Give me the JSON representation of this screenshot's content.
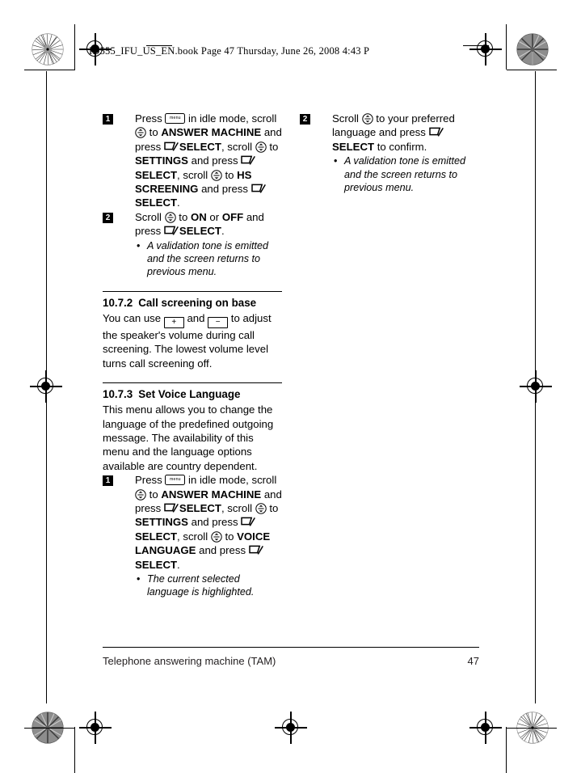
{
  "header": {
    "text": "ID555_IFU_US_EN.book  Page 47  Thursday, June 26, 2008  4:43 P"
  },
  "icons": {
    "menu_label": "menu",
    "volume_up_label": "+",
    "volume_down_label": "−",
    "scroll_name": "scroll-wheel-icon",
    "softkey_name": "softkey-icon"
  },
  "left_column": {
    "step1": {
      "number": "1",
      "t1": "Press ",
      "t2": " in idle mode, scroll ",
      "t3": " to ",
      "b1": "ANSWER MACHINE",
      "t4": " and press ",
      "b2": "SELECT",
      "t5": ", scroll ",
      "t6": " to ",
      "b3": "SETTINGS",
      "t7": " and press ",
      "b4": "SELECT",
      "t8": ", scroll ",
      "t9": " to ",
      "b5": "HS SCREENING",
      "t10": " and press ",
      "b6": "SELECT",
      "t11": "."
    },
    "step2": {
      "number": "2",
      "t1": "Scroll ",
      "t2": " to ",
      "b1": "ON",
      "t3": " or ",
      "b2": "OFF",
      "t4": " and press ",
      "b3": "SELECT",
      "t5": ".",
      "note_bullet": "•",
      "note": "A validation tone is emitted and the screen returns to previous menu."
    },
    "section_1072": {
      "number": "10.7.2",
      "title": "Call screening on base",
      "p1": "You can use ",
      "p2": " and ",
      "p3": " to adjust the speaker's volume during call screening. The lowest volume level turns call screening off."
    },
    "section_1073": {
      "number": "10.7.3",
      "title": "Set Voice Language",
      "paragraph": "This menu allows you to change the language of the predefined outgoing message. The availability of this menu and the language options available are country dependent.",
      "step1": {
        "number": "1",
        "t1": "Press ",
        "t2": " in idle mode, scroll ",
        "t3": " to ",
        "b1": "ANSWER MACHINE",
        "t4": " and press ",
        "b2": "SELECT",
        "t5": ", scroll ",
        "t6": " to ",
        "b3": "SETTINGS",
        "t7": " and press ",
        "b4": "SELECT",
        "t8": ", scroll ",
        "t9": " to ",
        "b5": "VOICE LANGUAGE",
        "t10": " and press ",
        "b6": "SELECT",
        "t11": ".",
        "note_bullet": "•",
        "note": "The current selected language is highlighted."
      }
    }
  },
  "right_column": {
    "step2": {
      "number": "2",
      "t1": "Scroll ",
      "t2": " to your preferred language and press ",
      "b1": "SELECT",
      "t3": " to confirm.",
      "note_bullet": "•",
      "note": "A validation tone is emitted and the screen returns to previous menu."
    }
  },
  "footer": {
    "chapter": "Telephone answering machine (TAM)",
    "page_number": "47"
  }
}
